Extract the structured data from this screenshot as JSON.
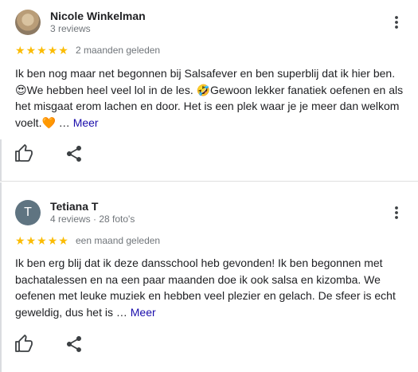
{
  "reviews": [
    {
      "author": "Nicole Winkelman",
      "meta": "3 reviews",
      "stars": 5,
      "date": "2 maanden geleden",
      "text_1": "Ik ben nog maar net begonnen bij Salsafever en ben superblij dat ik hier ben. ",
      "emoji_1": "😍",
      "text_2": "We hebben heel veel lol in de les. ",
      "emoji_2": "🤣",
      "text_3": "Gewoon lekker fanatiek oefenen en als het misgaat erom lachen en door. Het is een plek waar je je meer dan welkom voelt.",
      "emoji_3": "🧡",
      "ellipsis": " … ",
      "more_label": "Meer"
    },
    {
      "author": "Tetiana T",
      "avatar_letter": "T",
      "meta": "4 reviews · 28 foto's",
      "stars": 5,
      "date": "een maand geleden",
      "text_1": "Ik ben erg blij dat ik deze dansschool heb gevonden! Ik ben begonnen met bachatalessen en na een paar maanden doe ik ook salsa en kizomba. We oefenen met leuke muziek en hebben veel plezier en gelach. De sfeer is echt geweldig, dus het is",
      "ellipsis": " … ",
      "more_label": "Meer"
    }
  ],
  "colors": {
    "star": "#fbbc04",
    "link": "#1a0dab",
    "muted": "#70757a"
  },
  "icons": [
    "more-vert-icon",
    "thumb-up-icon",
    "share-icon",
    "star-icon"
  ]
}
